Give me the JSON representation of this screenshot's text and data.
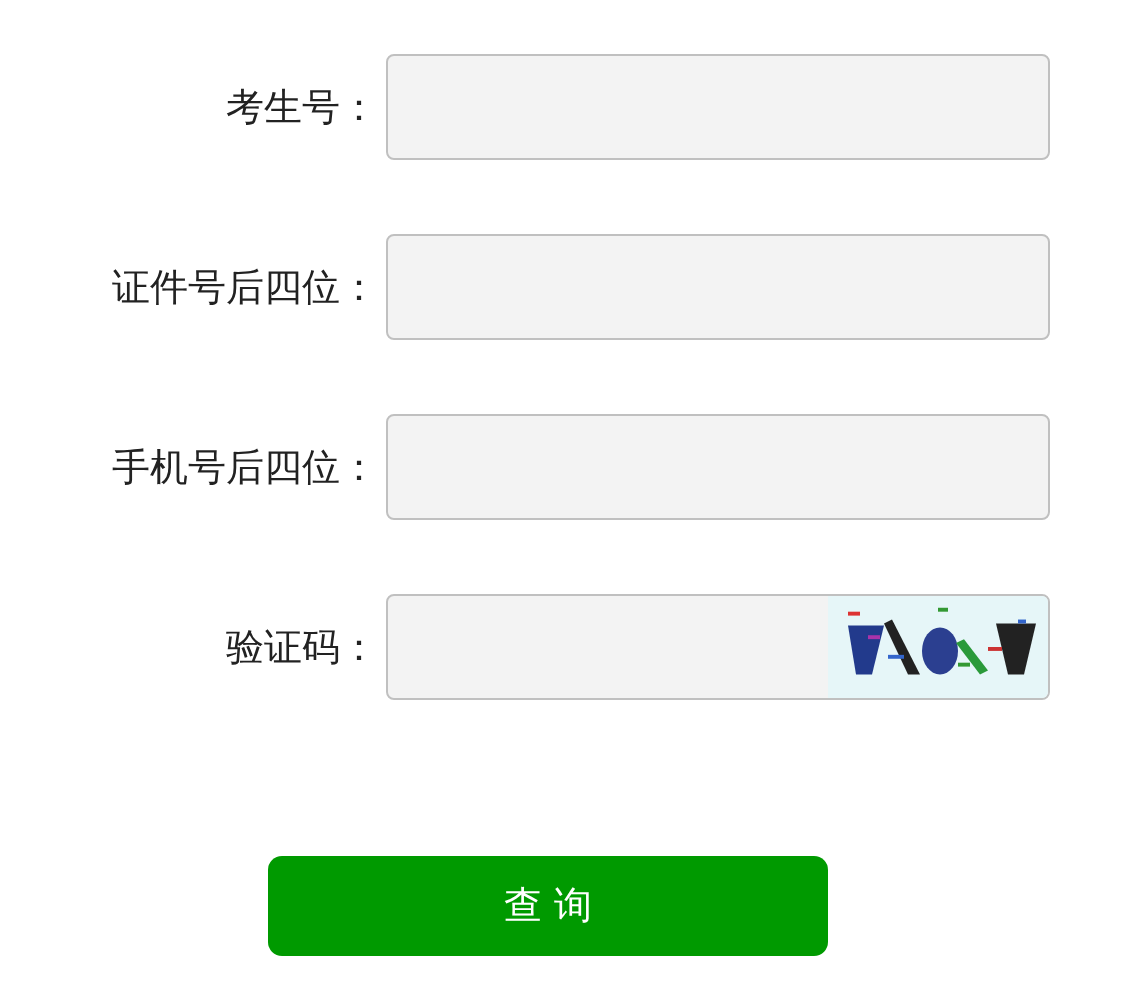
{
  "fields": [
    {
      "label": "考生号：",
      "kind": "text"
    },
    {
      "label": "证件号后四位：",
      "kind": "text"
    },
    {
      "label": "手机号后四位：",
      "kind": "text"
    },
    {
      "label": "验证码：",
      "kind": "captcha"
    }
  ],
  "submit_button": "查 询"
}
